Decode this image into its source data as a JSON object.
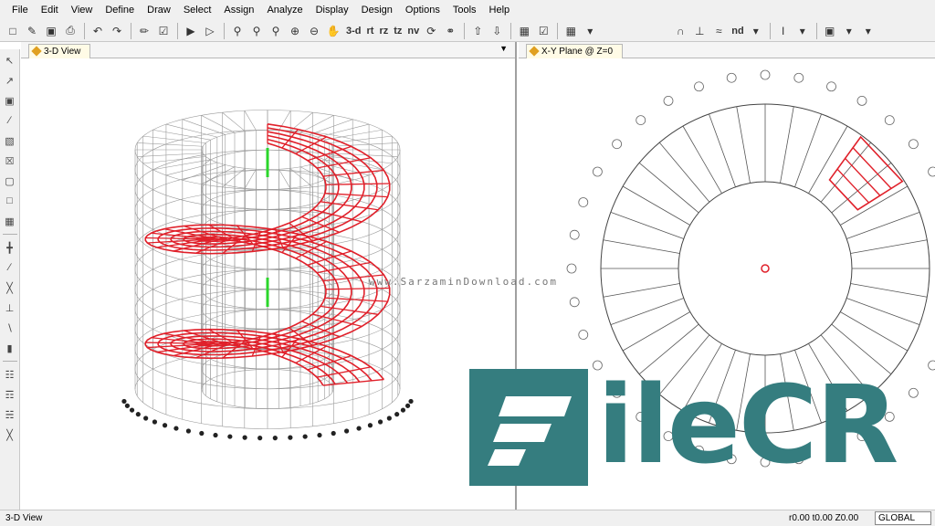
{
  "menu": [
    "File",
    "Edit",
    "View",
    "Define",
    "Draw",
    "Select",
    "Assign",
    "Analyze",
    "Display",
    "Design",
    "Options",
    "Tools",
    "Help"
  ],
  "toolbar": {
    "view_buttons": [
      "3-d",
      "rt",
      "rz",
      "tz",
      "nv"
    ],
    "nd_label": "nd"
  },
  "panes": {
    "left": {
      "title": "3-D View"
    },
    "right": {
      "title": "X-Y Plane @ Z=0"
    }
  },
  "status": {
    "left_text": "3-D View",
    "coords": "r0.00  t0.00  Z0.00",
    "coord_system": "GLOBAL"
  },
  "watermark": {
    "url": "www.SarzaminDownload.com",
    "logo_text": "ileCR"
  },
  "colors": {
    "accent_red": "#e0202a",
    "grid_gray": "#9a9a9a",
    "logo_teal": "#357d7f",
    "support_green": "#2bd62b"
  }
}
